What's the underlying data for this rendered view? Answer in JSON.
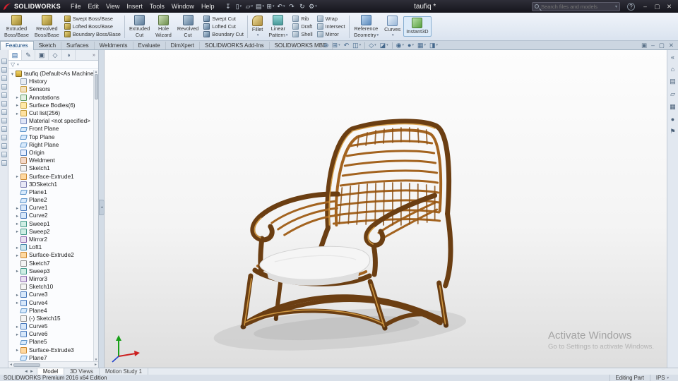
{
  "titlebar": {
    "logo_text": "SOLIDWORKS",
    "menus": [
      {
        "label": "File"
      },
      {
        "label": "Edit"
      },
      {
        "label": "View"
      },
      {
        "label": "Insert"
      },
      {
        "label": "Tools"
      },
      {
        "label": "Window"
      },
      {
        "label": "Help"
      }
    ],
    "quick_icons": [
      {
        "glyph": "↧",
        "name": "pin-icon"
      },
      {
        "glyph": "▯",
        "name": "new-document-icon",
        "arrow": true
      },
      {
        "glyph": "▱",
        "name": "open-icon",
        "arrow": true
      },
      {
        "glyph": "▤",
        "name": "save-icon",
        "arrow": true
      },
      {
        "glyph": "⊞",
        "name": "print-icon",
        "arrow": true
      },
      {
        "glyph": "↶",
        "name": "undo-icon",
        "arrow": true
      },
      {
        "glyph": "↷",
        "name": "redo-icon"
      },
      {
        "glyph": "↻",
        "name": "rebuild-icon"
      },
      {
        "glyph": "⚙",
        "name": "options-icon",
        "arrow": true
      }
    ],
    "document_title": "taufiq *",
    "search_placeholder": "Search files and models",
    "search_arrow": "▾",
    "help_glyph": "?",
    "window_controls": [
      {
        "glyph": "‒",
        "name": "minimize-button"
      },
      {
        "glyph": "▢",
        "name": "maximize-button"
      },
      {
        "glyph": "✕",
        "name": "close-button"
      }
    ]
  },
  "ribbon": {
    "columns": [
      {
        "large": true,
        "l1": "Extruded",
        "l2": "Boss/Base",
        "icon": "i-boss",
        "name": "extruded-boss-base-button"
      },
      {
        "large": true,
        "l1": "Revolved",
        "l2": "Boss/Base",
        "icon": "i-boss",
        "name": "revolved-boss-base-button"
      },
      {
        "stack": [
          {
            "label": "Swept Boss/Base",
            "icon": "i-boss",
            "name": "swept-boss-base-button"
          },
          {
            "label": "Lofted Boss/Base",
            "icon": "i-boss",
            "name": "lofted-boss-base-button"
          },
          {
            "label": "Boundary Boss/Base",
            "icon": "i-boss",
            "name": "boundary-boss-base-button"
          }
        ]
      },
      {
        "sep": true
      },
      {
        "large": true,
        "l1": "Extruded",
        "l2": "Cut",
        "icon": "i-cut",
        "name": "extruded-cut-button"
      },
      {
        "large": true,
        "l1": "Hole",
        "l2": "Wizard",
        "icon": "i-hole",
        "name": "hole-wizard-button"
      },
      {
        "large": true,
        "l1": "Revolved",
        "l2": "Cut",
        "icon": "i-cut",
        "name": "revolved-cut-button"
      },
      {
        "stack": [
          {
            "label": "Swept Cut",
            "icon": "i-cut",
            "name": "swept-cut-button"
          },
          {
            "label": "Lofted Cut",
            "icon": "i-cut",
            "name": "lofted-cut-button"
          },
          {
            "label": "Boundary Cut",
            "icon": "i-cut",
            "name": "boundary-cut-button"
          }
        ]
      },
      {
        "sep": true
      },
      {
        "large": true,
        "l1": "Fillet",
        "l2": "",
        "icon": "i-fillet",
        "arrow": true,
        "name": "fillet-button"
      },
      {
        "large": true,
        "l1": "Linear",
        "l2": "Pattern",
        "icon": "i-pattern",
        "arrow": true,
        "name": "linear-pattern-button"
      },
      {
        "stack": [
          {
            "label": "Rib",
            "icon": "i-misc",
            "name": "rib-button"
          },
          {
            "label": "Draft",
            "icon": "i-misc",
            "name": "draft-button"
          },
          {
            "label": "Shell",
            "icon": "i-misc",
            "name": "shell-button"
          }
        ]
      },
      {
        "stack": [
          {
            "label": "Wrap",
            "icon": "i-misc",
            "name": "wrap-button"
          },
          {
            "label": "Intersect",
            "icon": "i-misc",
            "name": "intersect-button"
          },
          {
            "label": "Mirror",
            "icon": "i-misc",
            "name": "mirror-button"
          }
        ]
      },
      {
        "sep": true
      },
      {
        "large": true,
        "l1": "Reference",
        "l2": "Geometry",
        "icon": "i-ref",
        "arrow": true,
        "name": "reference-geometry-button"
      },
      {
        "large": true,
        "l1": "Curves",
        "l2": "",
        "icon": "i-curve",
        "arrow": true,
        "name": "curves-button"
      },
      {
        "large": true,
        "l1": "Instant3D",
        "l2": "",
        "icon": "i-i3d",
        "state": "active",
        "name": "instant3d-button"
      }
    ]
  },
  "ribbon_tabs": {
    "items": [
      {
        "label": "Features",
        "state": "active",
        "name": "tab-features"
      },
      {
        "label": "Sketch",
        "name": "tab-sketch"
      },
      {
        "label": "Surfaces",
        "name": "tab-surfaces"
      },
      {
        "label": "Weldments",
        "name": "tab-weldments"
      },
      {
        "label": "Evaluate",
        "name": "tab-evaluate"
      },
      {
        "label": "DimXpert",
        "name": "tab-dimxpert"
      },
      {
        "label": "SOLIDWORKS Add-Ins",
        "name": "tab-solidworks-add-ins"
      },
      {
        "label": "SOLIDWORKS MBD",
        "name": "tab-solidworks-mbd"
      }
    ]
  },
  "headsup": {
    "items": [
      {
        "glyph": "⊕",
        "name": "zoom-fit-icon"
      },
      {
        "glyph": "⊞",
        "name": "zoom-area-icon",
        "arrow": true
      },
      {
        "glyph": "↶",
        "name": "previous-view-icon"
      },
      {
        "glyph": "◫",
        "name": "section-view-icon",
        "arrow": true
      },
      {
        "sep": true
      },
      {
        "glyph": "◇",
        "name": "view-orientation-icon",
        "arrow": true
      },
      {
        "glyph": "◪",
        "name": "display-style-icon",
        "arrow": true
      },
      {
        "sep": true
      },
      {
        "glyph": "◉",
        "name": "hide-show-items-icon",
        "arrow": true
      },
      {
        "glyph": "●",
        "name": "edit-appearance-icon",
        "arrow": true
      },
      {
        "glyph": "▦",
        "name": "apply-scene-icon",
        "arrow": true
      },
      {
        "glyph": "◨",
        "name": "view-settings-icon",
        "arrow": true
      }
    ]
  },
  "docwin": {
    "items": [
      {
        "glyph": "▣",
        "name": "doc-newwindow-icon"
      },
      {
        "glyph": "‒",
        "name": "doc-minimize-icon"
      },
      {
        "glyph": "▢",
        "name": "doc-restore-icon"
      },
      {
        "glyph": "✕",
        "name": "doc-close-icon"
      }
    ]
  },
  "left_dock": {
    "items": [
      {},
      {},
      {},
      {},
      {},
      {},
      {},
      {},
      {},
      {},
      {},
      {},
      {}
    ]
  },
  "feature_tree": {
    "tabs": [
      {
        "glyph": "▤",
        "state": "active",
        "name": "featuremanager-tab"
      },
      {
        "glyph": "✎",
        "name": "propertymanager-tab"
      },
      {
        "glyph": "▣",
        "name": "configurationmanager-tab"
      },
      {
        "glyph": "◇",
        "name": "dimxpertmanager-tab"
      },
      {
        "glyph": "◑",
        "name": "displaymanager-tab"
      }
    ],
    "overflow_glyph": "»",
    "filter_glyph": "▽",
    "filter_arrow": "▾",
    "items": [
      {
        "ind": "ind0",
        "caret": "▾",
        "icon": "t-part",
        "label": "taufiq (Default<As Machined><<Defa"
      },
      {
        "ind": "ind1",
        "caret": "",
        "icon": "t-history",
        "label": "History"
      },
      {
        "ind": "ind1",
        "caret": "",
        "icon": "t-sensors",
        "label": "Sensors"
      },
      {
        "ind": "ind1",
        "caret": "▸",
        "icon": "t-annot",
        "label": "Annotations"
      },
      {
        "ind": "ind1",
        "caret": "▸",
        "icon": "t-folder",
        "label": "Surface Bodies(6)"
      },
      {
        "ind": "ind1",
        "caret": "▸",
        "icon": "t-cutlist",
        "label": "Cut list(256)"
      },
      {
        "ind": "ind1",
        "caret": "",
        "icon": "t-material",
        "label": "Material <not specified>"
      },
      {
        "ind": "ind1",
        "caret": "",
        "icon": "t-plane",
        "label": "Front Plane"
      },
      {
        "ind": "ind1",
        "caret": "",
        "icon": "t-plane",
        "label": "Top Plane"
      },
      {
        "ind": "ind1",
        "caret": "",
        "icon": "t-plane",
        "label": "Right Plane"
      },
      {
        "ind": "ind1",
        "caret": "",
        "icon": "t-origin",
        "label": "Origin"
      },
      {
        "ind": "ind1",
        "caret": "",
        "icon": "t-weldment",
        "label": "Weldment"
      },
      {
        "ind": "ind1",
        "caret": "",
        "icon": "t-sketch",
        "label": "Sketch1"
      },
      {
        "ind": "ind1",
        "caret": "▸",
        "icon": "t-surfext",
        "label": "Surface-Extrude1"
      },
      {
        "ind": "ind1",
        "caret": "",
        "icon": "t-sketch3d",
        "label": "3DSketch1"
      },
      {
        "ind": "ind1",
        "caret": "",
        "icon": "t-plane",
        "label": "Plane1"
      },
      {
        "ind": "ind1",
        "caret": "",
        "icon": "t-plane",
        "label": "Plane2"
      },
      {
        "ind": "ind1",
        "caret": "▸",
        "icon": "t-curve",
        "label": "Curve1"
      },
      {
        "ind": "ind1",
        "caret": "▸",
        "icon": "t-curve",
        "label": "Curve2"
      },
      {
        "ind": "ind1",
        "caret": "▸",
        "icon": "t-sweep",
        "label": "Sweep1"
      },
      {
        "ind": "ind1",
        "caret": "▸",
        "icon": "t-sweep",
        "label": "Sweep2"
      },
      {
        "ind": "ind1",
        "caret": "",
        "icon": "t-mirror",
        "label": "Mirror2"
      },
      {
        "ind": "ind1",
        "caret": "▸",
        "icon": "t-loft",
        "label": "Loft1"
      },
      {
        "ind": "ind1",
        "caret": "▸",
        "icon": "t-surfext",
        "label": "Surface-Extrude2"
      },
      {
        "ind": "ind1",
        "caret": "",
        "icon": "t-sketch",
        "label": "Sketch7"
      },
      {
        "ind": "ind1",
        "caret": "▸",
        "icon": "t-sweep",
        "label": "Sweep3"
      },
      {
        "ind": "ind1",
        "caret": "",
        "icon": "t-mirror",
        "label": "Mirror3"
      },
      {
        "ind": "ind1",
        "caret": "",
        "icon": "t-sketch",
        "label": "Sketch10"
      },
      {
        "ind": "ind1",
        "caret": "▸",
        "icon": "t-curve",
        "label": "Curve3"
      },
      {
        "ind": "ind1",
        "caret": "▸",
        "icon": "t-curve",
        "label": "Curve4"
      },
      {
        "ind": "ind1",
        "caret": "",
        "icon": "t-plane",
        "label": "Plane4"
      },
      {
        "ind": "ind1",
        "caret": "",
        "icon": "t-sketch",
        "label": "(-) Sketch15"
      },
      {
        "ind": "ind1",
        "caret": "▸",
        "icon": "t-curve",
        "label": "Curve5"
      },
      {
        "ind": "ind1",
        "caret": "▸",
        "icon": "t-curve",
        "label": "Curve6"
      },
      {
        "ind": "ind1",
        "caret": "",
        "icon": "t-plane",
        "label": "Plane5"
      },
      {
        "ind": "ind1",
        "caret": "▸",
        "icon": "t-surfext",
        "label": "Surface-Extrude3"
      },
      {
        "ind": "ind1",
        "caret": "",
        "icon": "t-plane",
        "label": "Plane7"
      }
    ]
  },
  "viewport": {
    "watermark_line1": "Activate Windows",
    "watermark_line2": "Go to Settings to activate Windows."
  },
  "taskpane": {
    "items": [
      {
        "glyph": "«",
        "name": "taskpane-collapse-icon"
      },
      {
        "glyph": "⌂",
        "name": "solidworks-resources-icon"
      },
      {
        "glyph": "▤",
        "name": "design-library-icon"
      },
      {
        "glyph": "▱",
        "name": "file-explorer-icon"
      },
      {
        "glyph": "▦",
        "name": "view-palette-icon"
      },
      {
        "glyph": "●",
        "name": "appearances-scenes-icon"
      },
      {
        "glyph": "⚑",
        "name": "custom-properties-icon"
      }
    ]
  },
  "bottom_tabs": {
    "nav": [
      {
        "glyph": "◄",
        "name": "tab-scroll-left-icon"
      },
      {
        "glyph": "►",
        "name": "tab-scroll-right-icon"
      }
    ],
    "items": [
      {
        "label": "Model",
        "state": "active",
        "name": "tab-model"
      },
      {
        "label": "3D Views",
        "name": "tab-3d-views"
      },
      {
        "label": "Motion Study 1",
        "name": "tab-motion-study-1"
      }
    ]
  },
  "statusbar": {
    "left": "SOLIDWORKS Premium 2016 x64 Edition",
    "editing": "Editing Part",
    "units": "IPS",
    "units_arrow": "▾"
  }
}
